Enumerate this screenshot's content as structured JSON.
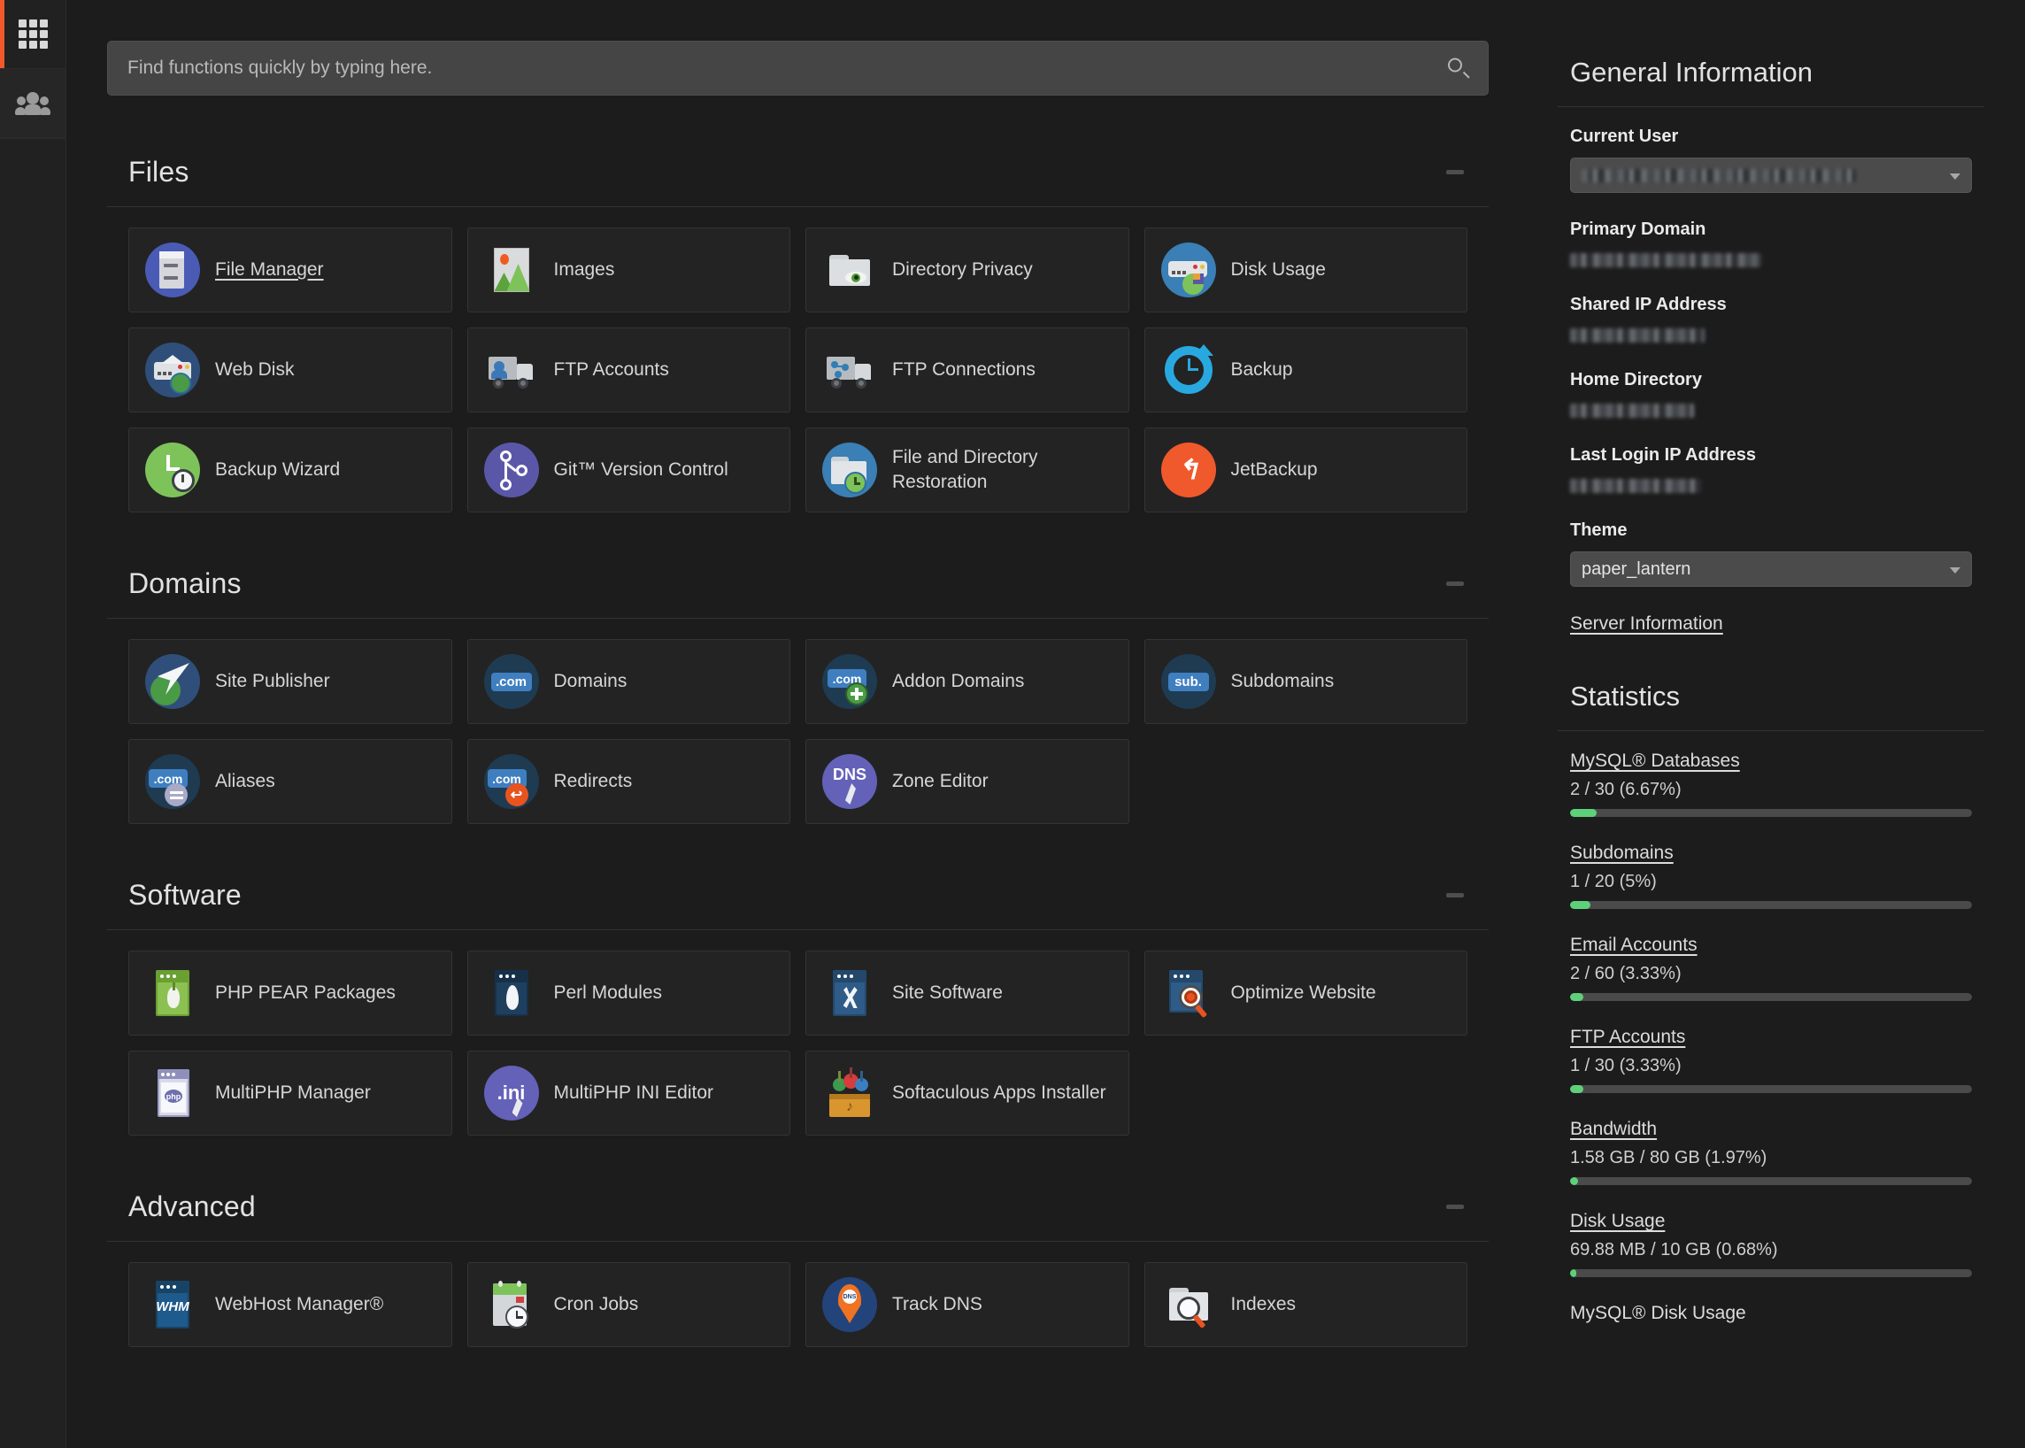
{
  "sidebar": {
    "items": [
      {
        "name": "apps-grid",
        "icon": "grid-icon",
        "active": true
      },
      {
        "name": "user-manager",
        "icon": "people-icon",
        "active": false
      }
    ]
  },
  "search": {
    "placeholder": "Find functions quickly by typing here.",
    "value": "",
    "icon": "search-icon"
  },
  "sections": [
    {
      "id": "files",
      "title": "Files",
      "collapse_icon": "minus-icon",
      "tiles": [
        {
          "label": "File Manager",
          "icon": "file-manager-icon",
          "underline": true
        },
        {
          "label": "Images",
          "icon": "images-icon",
          "underline": false
        },
        {
          "label": "Directory Privacy",
          "icon": "directory-privacy-icon",
          "underline": false
        },
        {
          "label": "Disk Usage",
          "icon": "disk-usage-icon",
          "underline": false
        },
        {
          "label": "Web Disk",
          "icon": "web-disk-icon",
          "underline": false
        },
        {
          "label": "FTP Accounts",
          "icon": "ftp-accounts-icon",
          "underline": false
        },
        {
          "label": "FTP Connections",
          "icon": "ftp-connections-icon",
          "underline": false
        },
        {
          "label": "Backup",
          "icon": "backup-icon",
          "underline": false
        },
        {
          "label": "Backup Wizard",
          "icon": "backup-wizard-icon",
          "underline": false
        },
        {
          "label": "Git™ Version Control",
          "icon": "git-icon",
          "underline": false
        },
        {
          "label": "File and Directory Restoration",
          "icon": "file-restore-icon",
          "underline": false
        },
        {
          "label": "JetBackup",
          "icon": "jetbackup-icon",
          "underline": false
        }
      ]
    },
    {
      "id": "domains",
      "title": "Domains",
      "collapse_icon": "minus-icon",
      "tiles": [
        {
          "label": "Site Publisher",
          "icon": "site-publisher-icon",
          "underline": false
        },
        {
          "label": "Domains",
          "icon": "domains-icon",
          "underline": false
        },
        {
          "label": "Addon Domains",
          "icon": "addon-domains-icon",
          "underline": false
        },
        {
          "label": "Subdomains",
          "icon": "subdomains-icon",
          "underline": false
        },
        {
          "label": "Aliases",
          "icon": "aliases-icon",
          "underline": false
        },
        {
          "label": "Redirects",
          "icon": "redirects-icon",
          "underline": false
        },
        {
          "label": "Zone Editor",
          "icon": "zone-editor-icon",
          "underline": false
        }
      ]
    },
    {
      "id": "software",
      "title": "Software",
      "collapse_icon": "minus-icon",
      "tiles": [
        {
          "label": "PHP PEAR Packages",
          "icon": "php-pear-icon",
          "underline": false
        },
        {
          "label": "Perl Modules",
          "icon": "perl-modules-icon",
          "underline": false
        },
        {
          "label": "Site Software",
          "icon": "site-software-icon",
          "underline": false
        },
        {
          "label": "Optimize Website",
          "icon": "optimize-website-icon",
          "underline": false
        },
        {
          "label": "MultiPHP Manager",
          "icon": "multiphp-manager-icon",
          "underline": false
        },
        {
          "label": "MultiPHP INI Editor",
          "icon": "multiphp-ini-icon",
          "underline": false
        },
        {
          "label": "Softaculous Apps Installer",
          "icon": "softaculous-icon",
          "underline": false
        }
      ]
    },
    {
      "id": "advanced",
      "title": "Advanced",
      "collapse_icon": "minus-icon",
      "tiles": [
        {
          "label": "WebHost Manager®",
          "icon": "whm-icon",
          "underline": false
        },
        {
          "label": "Cron Jobs",
          "icon": "cron-jobs-icon",
          "underline": false
        },
        {
          "label": "Track DNS",
          "icon": "track-dns-icon",
          "underline": false
        },
        {
          "label": "Indexes",
          "icon": "indexes-icon",
          "underline": false
        }
      ]
    }
  ],
  "general_information": {
    "title": "General Information",
    "current_user_label": "Current User",
    "current_user_value": "",
    "primary_domain_label": "Primary Domain",
    "primary_domain_value": "",
    "shared_ip_label": "Shared IP Address",
    "shared_ip_value": "",
    "home_directory_label": "Home Directory",
    "home_directory_value": "",
    "last_login_ip_label": "Last Login IP Address",
    "last_login_ip_value": "",
    "theme_label": "Theme",
    "theme_value": "paper_lantern",
    "server_information_link": "Server Information"
  },
  "statistics": {
    "title": "Statistics",
    "items": [
      {
        "name": "MySQL® Databases",
        "value": "2 / 30   (6.67%)",
        "percent": 6.67,
        "link": true
      },
      {
        "name": "Subdomains",
        "value": "1 / 20   (5%)",
        "percent": 5,
        "link": true
      },
      {
        "name": "Email Accounts",
        "value": "2 / 60   (3.33%)",
        "percent": 3.33,
        "link": true
      },
      {
        "name": "FTP Accounts",
        "value": "1 / 30   (3.33%)",
        "percent": 3.33,
        "link": true
      },
      {
        "name": "Bandwidth",
        "value": "1.58 GB / 80 GB   (1.97%)",
        "percent": 1.97,
        "link": true
      },
      {
        "name": "Disk Usage",
        "value": "69.88 MB / 10 GB   (0.68%)",
        "percent": 0.68,
        "link": true
      },
      {
        "name": "MySQL® Disk Usage",
        "value": "",
        "percent": 0.6,
        "link": false
      }
    ]
  },
  "colors": {
    "accent": "#f0592b",
    "page_bg": "#1c1c1c",
    "tile_bg": "#232323",
    "progress": "#5fd07a",
    "progress_track": "#4a4a4a"
  }
}
